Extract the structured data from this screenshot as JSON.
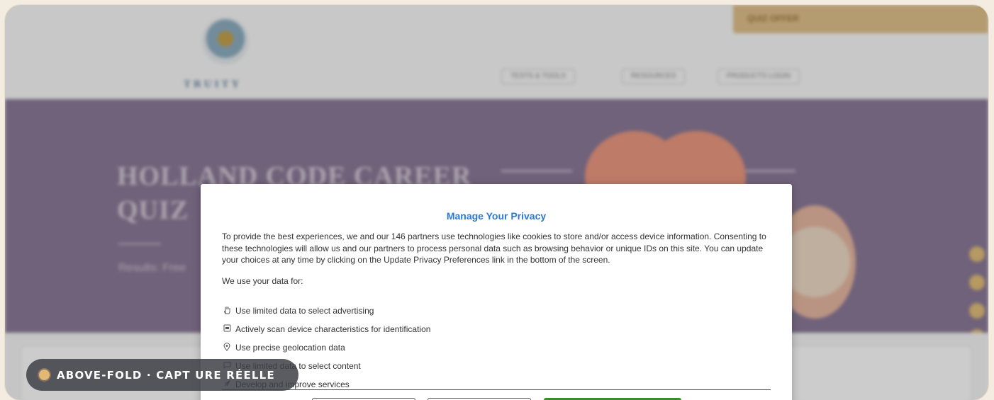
{
  "site": {
    "logo_text": "TRUITY",
    "promo_tab": "QUIZ OFFER",
    "nav": [
      "TESTS & TOOLS",
      "RESOURCES",
      "PRODUCTS LOGIN"
    ],
    "hero_title": "HOLLAND CODE CAREER QUIZ",
    "hero_subtitle": "Results: Free"
  },
  "modal": {
    "title": "Manage Your Privacy",
    "body": "To provide the best experiences, we and our 146 partners use technologies like cookies to store and/or access device information. Consenting to these technologies will allow us and our partners to process personal data such as browsing behavior or unique IDs on this site. You can update your choices at any time by clicking on the Update Privacy Preferences link in the bottom of the screen.",
    "uses_label": "We use your data for:",
    "purposes": [
      {
        "icon": "hand-icon",
        "label": "Use limited data to select advertising"
      },
      {
        "icon": "device-scan-icon",
        "label": "Actively scan device characteristics for identification"
      },
      {
        "icon": "location-pin-icon",
        "label": "Use precise geolocation data"
      },
      {
        "icon": "content-icon",
        "label": "Use limited data to select content"
      },
      {
        "icon": "rocket-icon",
        "label": "Develop and improve services"
      }
    ]
  },
  "badge": {
    "text": "ABOVE-FOLD · CAPT URE RÉELLE",
    "dot_color": "#e2b874"
  },
  "colors": {
    "modal_title": "#2b79d3",
    "accept_button": "#3a8c2f",
    "hero_bg": "#8c7b99",
    "promo_tab": "#e2c38c"
  }
}
